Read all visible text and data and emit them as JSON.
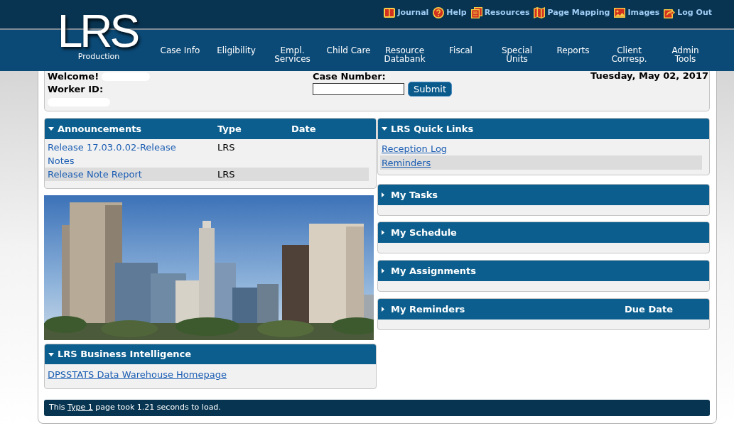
{
  "top_links": [
    "Journal",
    "Help",
    "Resources",
    "Page Mapping",
    "Images",
    "Log Out"
  ],
  "logo": {
    "title": "LRS",
    "subtitle": "Production"
  },
  "nav": [
    "Case Info",
    "Eligibility",
    "Empl. Services",
    "Child Care",
    "Resource Databank",
    "Fiscal",
    "Special Units",
    "Reports",
    "Client Corresp.",
    "Admin Tools"
  ],
  "info": {
    "welcome": "Welcome!",
    "worker_id": "Worker ID:",
    "case_number_label": "Case Number:",
    "submit": "Submit",
    "date": "Tuesday, May 02, 2017"
  },
  "announcements": {
    "title": "Announcements",
    "expanded": true,
    "columns": [
      "Type",
      "Date"
    ],
    "rows": [
      {
        "title": "Release 17.03.0.02-Release Notes",
        "type": "LRS"
      },
      {
        "title": "Release Note Report",
        "type": "LRS"
      }
    ]
  },
  "business_intelligence": {
    "title": "LRS Business Intelligence",
    "expanded": true,
    "links": [
      "DPSSTATS Data Warehouse Homepage"
    ]
  },
  "right_panels": [
    {
      "title": "LRS Quick Links",
      "expanded": true,
      "links": [
        "Reception Log",
        "Reminders"
      ]
    },
    {
      "title": "My Tasks",
      "expanded": false
    },
    {
      "title": "My Schedule",
      "expanded": false
    },
    {
      "title": "My Assignments",
      "expanded": false
    },
    {
      "title": "My Reminders",
      "expanded": false,
      "columns": [
        "Due Date"
      ]
    }
  ],
  "status_bar": {
    "before": "This",
    "link": "Type 1",
    "after": "page took 1.21 seconds to load."
  }
}
